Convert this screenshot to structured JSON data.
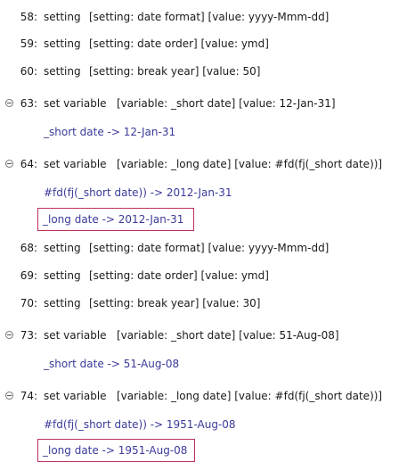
{
  "lines": [
    {
      "num": "58:",
      "cmd": "setting",
      "args": "[setting: date format] [value: yyyy-Mmm-dd]"
    },
    {
      "num": "59:",
      "cmd": "setting",
      "args": "[setting: date order] [value: ymd]"
    },
    {
      "num": "60:",
      "cmd": "setting",
      "args": "[setting: break year] [value: 50]"
    },
    {
      "num": "63:",
      "cmd": "set variable",
      "args": "[variable: _short date] [value: 12-Jan-31]"
    },
    {
      "num": "64:",
      "cmd": "set variable",
      "args": "[variable: _long date] [value: #fd(fj(_short date))]"
    },
    {
      "num": "68:",
      "cmd": "setting",
      "args": "[setting: date format] [value: yyyy-Mmm-dd]"
    },
    {
      "num": "69:",
      "cmd": "setting",
      "args": "[setting: date order] [value: ymd]"
    },
    {
      "num": "70:",
      "cmd": "setting",
      "args": "[setting: break year] [value: 30]"
    },
    {
      "num": "73:",
      "cmd": "set variable",
      "args": "[variable: _short date] [value: 51-Aug-08]"
    },
    {
      "num": "74:",
      "cmd": "set variable",
      "args": "[variable: _long date] [value: #fd(fj(_short date))]"
    }
  ],
  "traces": {
    "t63": "_short date  ->  12-Jan-31",
    "t64a": "#fd(fj(_short date)) -> 2012-Jan-31",
    "t64b": "_long date  ->  2012-Jan-31",
    "t73": "_short date  ->  51-Aug-08",
    "t74a": "#fd(fj(_short date)) -> 1951-Aug-08",
    "t74b": "_long date  ->  1951-Aug-08"
  }
}
